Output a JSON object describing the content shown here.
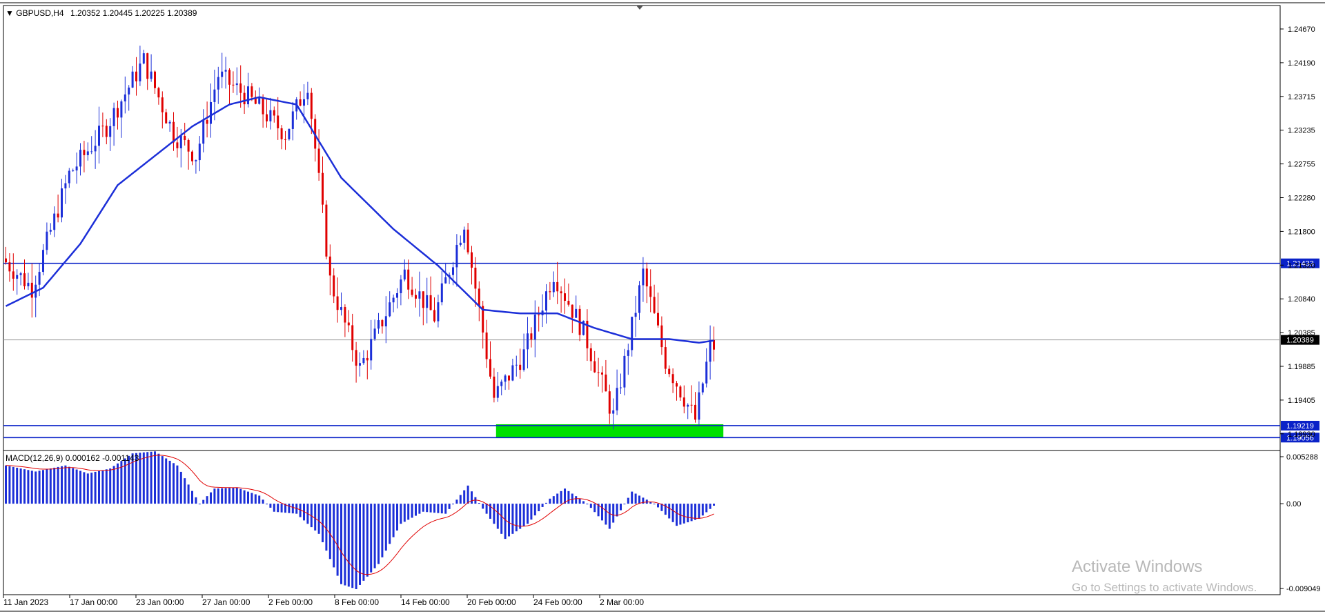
{
  "header": {
    "symbol": "GBPUSD,H4",
    "ohlc": "1.20352 1.20445 1.20225 1.20389",
    "macd_label": "MACD(12,26,9) 0.000162 -0.001143"
  },
  "watermark": {
    "line1": "Activate Windows",
    "line2": "Go to Settings to activate Windows."
  },
  "colors": {
    "bull": "#1c2fd8",
    "bear": "#e00000",
    "ma": "#1c2fd8",
    "level": "#0a22c8",
    "zone": "#00e000",
    "signal": "#e00000",
    "hist": "#1c2fd8"
  },
  "chart_data": [
    {
      "type": "candlestick",
      "title": "GBPUSD,H4",
      "y_ticks": [
        "1.24670",
        "1.24190",
        "1.23715",
        "1.23235",
        "1.22755",
        "1.22280",
        "1.21800",
        "1.21320",
        "1.20840",
        "1.20385",
        "1.19885",
        "1.19405",
        "1.18930"
      ],
      "ylim": [
        1.1888,
        1.2495
      ],
      "x_ticks": [
        "11 Jan 2023",
        "17 Jan 00:00",
        "23 Jan 00:00",
        "27 Jan 00:00",
        "2 Feb 00:00",
        "8 Feb 00:00",
        "14 Feb 00:00",
        "20 Feb 00:00",
        "24 Feb 00:00",
        "2 Mar 00:00"
      ],
      "current_price": "1.20389",
      "levels": [
        {
          "value": 1.21433,
          "label": "1.21433"
        },
        {
          "value": 1.19219,
          "label": "1.19219"
        },
        {
          "value": 1.19056,
          "label": "1.19056"
        }
      ],
      "support_zone": {
        "low": 1.19056,
        "high": 1.19219,
        "from_bar": 132,
        "to_bar": 193
      },
      "price_path": [
        [
          0,
          1.215
        ],
        [
          8,
          1.211
        ],
        [
          18,
          1.2265
        ],
        [
          28,
          1.233
        ],
        [
          38,
          1.242
        ],
        [
          46,
          1.232
        ],
        [
          52,
          1.229
        ],
        [
          58,
          1.24
        ],
        [
          66,
          1.237
        ],
        [
          76,
          1.232
        ],
        [
          82,
          1.239
        ],
        [
          88,
          1.212
        ],
        [
          96,
          1.2
        ],
        [
          108,
          1.213
        ],
        [
          116,
          1.207
        ],
        [
          124,
          1.22
        ],
        [
          132,
          1.196
        ],
        [
          140,
          1.202
        ],
        [
          148,
          1.213
        ],
        [
          156,
          1.205
        ],
        [
          164,
          1.1935
        ],
        [
          172,
          1.213
        ],
        [
          178,
          1.201
        ],
        [
          186,
          1.193
        ],
        [
          190,
          1.203
        ]
      ],
      "ma_path": [
        [
          0,
          1.2085
        ],
        [
          10,
          1.211
        ],
        [
          20,
          1.217
        ],
        [
          30,
          1.225
        ],
        [
          40,
          1.229
        ],
        [
          50,
          1.233
        ],
        [
          60,
          1.236
        ],
        [
          68,
          1.237
        ],
        [
          78,
          1.236
        ],
        [
          90,
          1.226
        ],
        [
          104,
          1.219
        ],
        [
          116,
          1.214
        ],
        [
          128,
          1.208
        ],
        [
          138,
          1.2075
        ],
        [
          148,
          1.2075
        ],
        [
          158,
          1.2055
        ],
        [
          168,
          1.204
        ],
        [
          178,
          1.204
        ],
        [
          186,
          1.2035
        ],
        [
          190,
          1.2038
        ]
      ],
      "bar_count": 191,
      "seed": 7
    },
    {
      "type": "bar",
      "title": "MACD(12,26,9)",
      "series": [
        {
          "name": "MACD",
          "kind": "histogram"
        },
        {
          "name": "Signal",
          "kind": "line"
        }
      ],
      "y_ticks": [
        "0.005288",
        "0.00",
        "-0.009049"
      ],
      "ylim": [
        -0.009049,
        0.005288
      ],
      "macd_path": [
        [
          0,
          0.0038
        ],
        [
          8,
          0.0032
        ],
        [
          16,
          0.0038
        ],
        [
          22,
          0.003
        ],
        [
          28,
          0.0035
        ],
        [
          34,
          0.005
        ],
        [
          40,
          0.0052
        ],
        [
          46,
          0.0038
        ],
        [
          52,
          0.0
        ],
        [
          56,
          0.0015
        ],
        [
          62,
          0.0016
        ],
        [
          68,
          0.0008
        ],
        [
          72,
          -0.0008
        ],
        [
          78,
          -0.001
        ],
        [
          84,
          -0.003
        ],
        [
          90,
          -0.008
        ],
        [
          94,
          -0.0085
        ],
        [
          100,
          -0.006
        ],
        [
          106,
          -0.002
        ],
        [
          112,
          -0.0008
        ],
        [
          118,
          -0.001
        ],
        [
          124,
          0.0018
        ],
        [
          128,
          -0.0005
        ],
        [
          134,
          -0.0035
        ],
        [
          140,
          -0.002
        ],
        [
          146,
          0.0005
        ],
        [
          150,
          0.0015
        ],
        [
          156,
          0.0
        ],
        [
          162,
          -0.0025
        ],
        [
          168,
          0.0012
        ],
        [
          174,
          0.0
        ],
        [
          180,
          -0.0022
        ],
        [
          186,
          -0.0015
        ],
        [
          190,
          -0.0002
        ]
      ],
      "signal_lag": 6
    }
  ]
}
